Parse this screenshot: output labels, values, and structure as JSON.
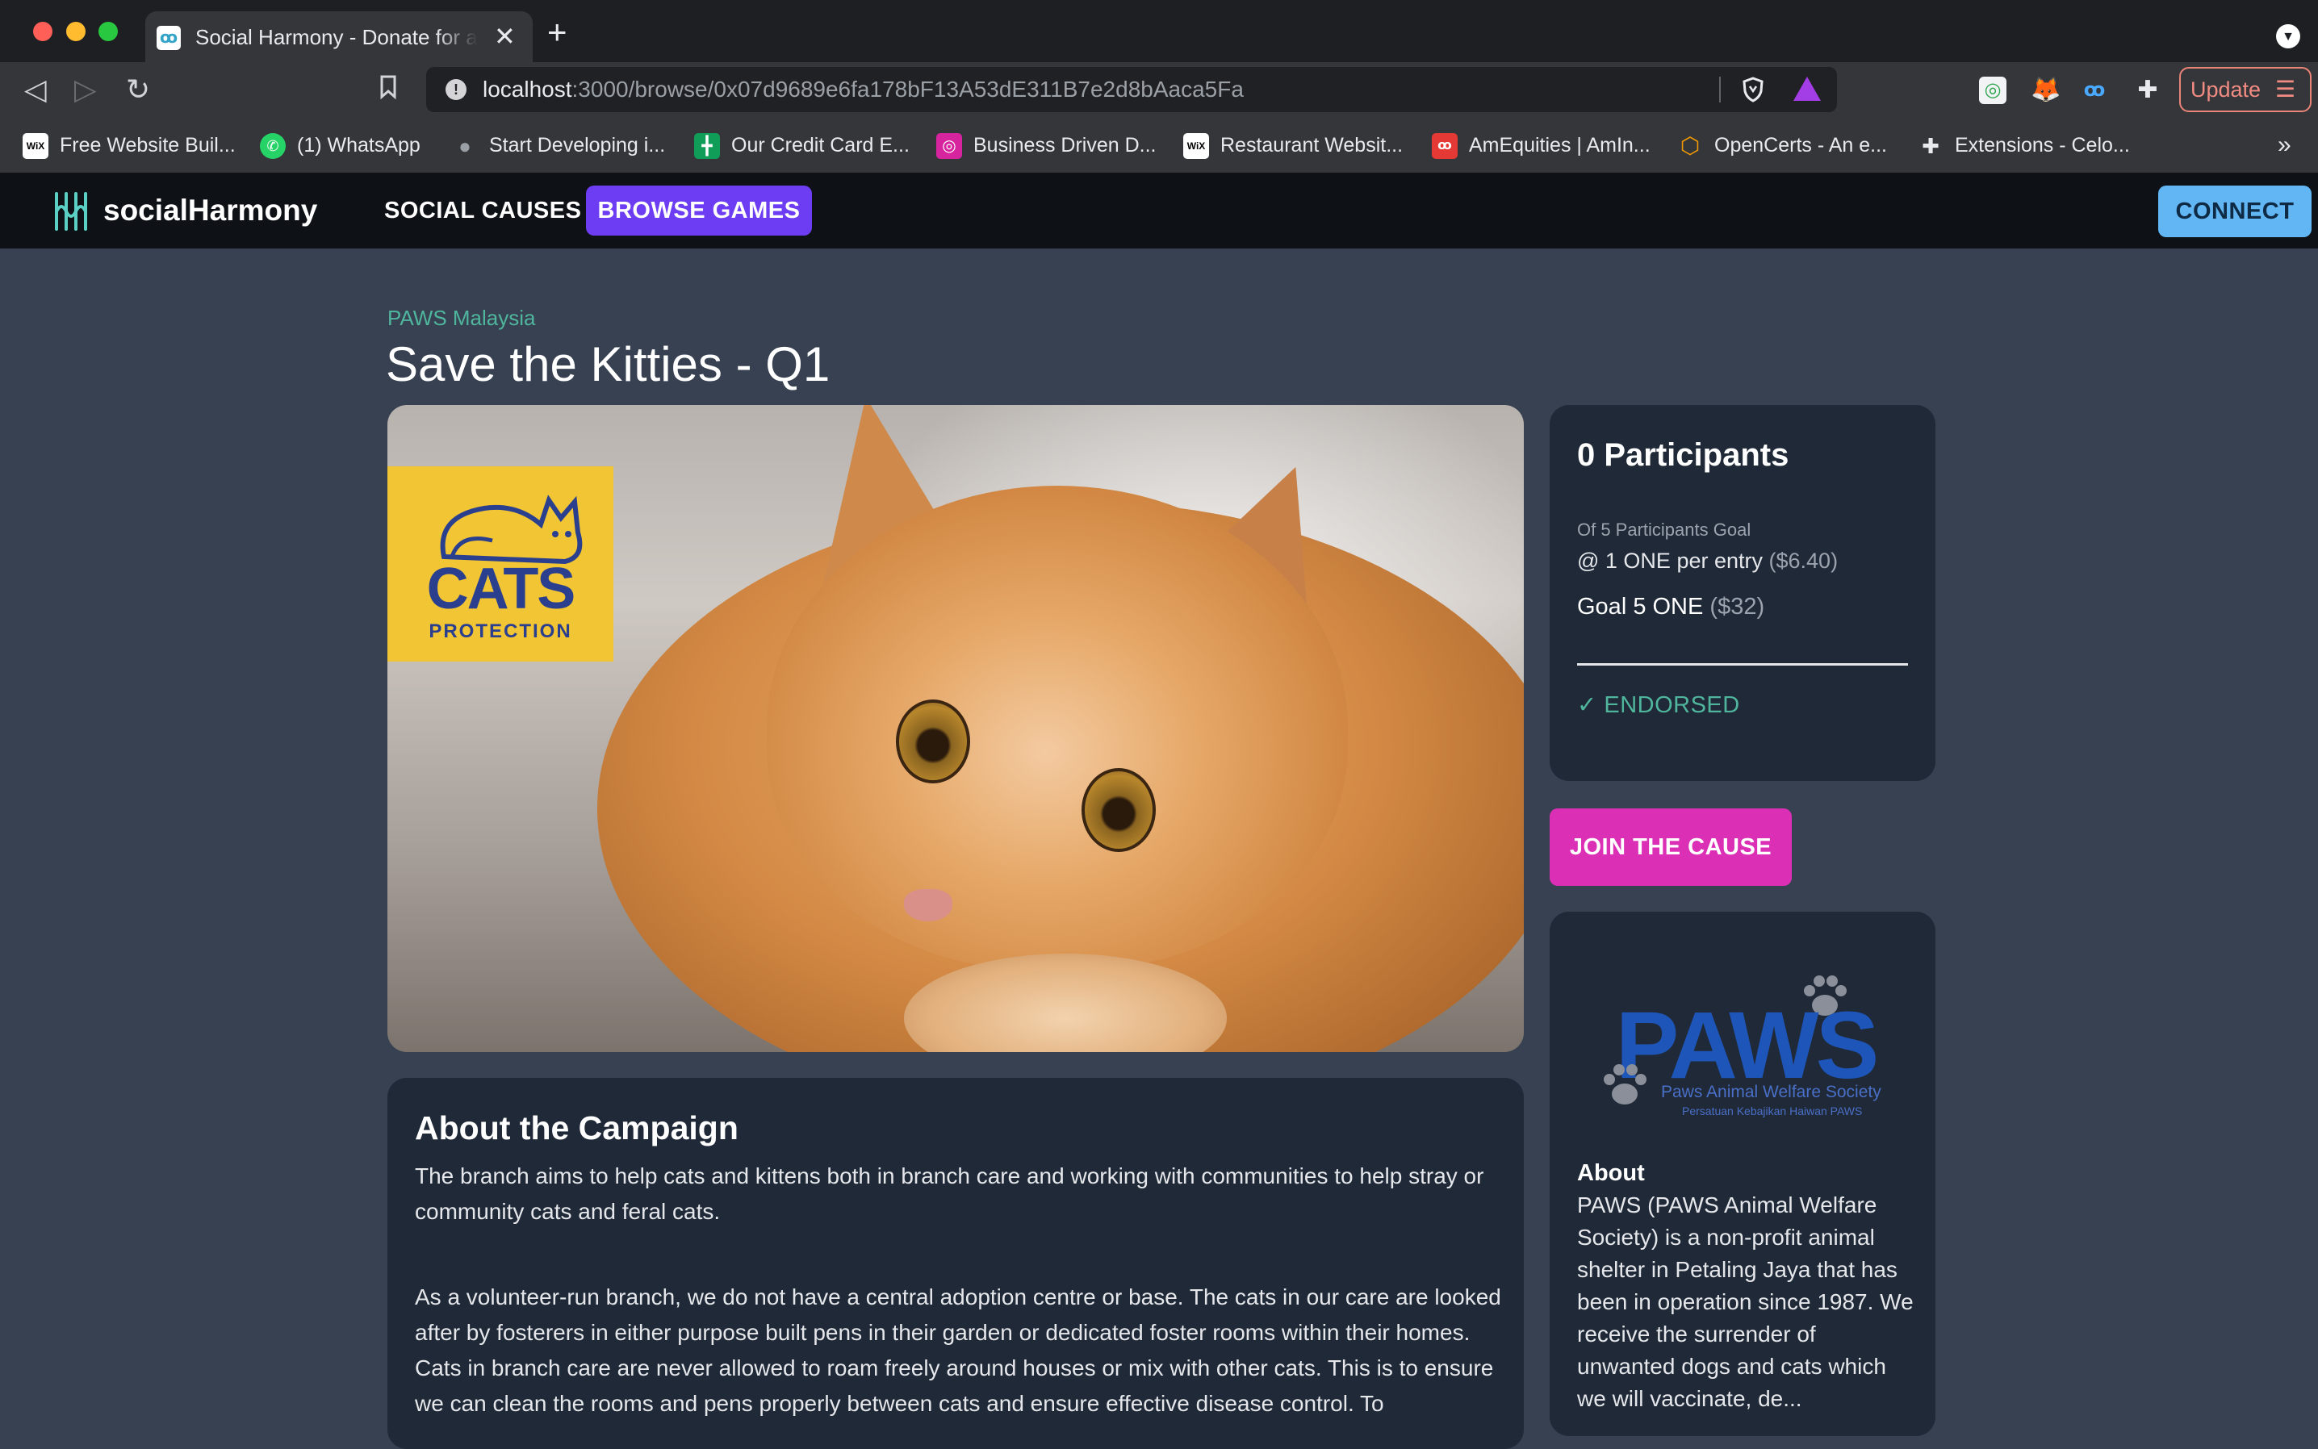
{
  "browser": {
    "tab_title": "Social Harmony - Donate for a Cause",
    "url_host": "localhost",
    "url_path": ":3000/browse/0x07d9689e6fa178bF13A53dE311B7e2d8bAaca5Fa",
    "update_label": "Update",
    "bookmarks": [
      {
        "label": "Free Website Buil...",
        "icon": "wix-icon"
      },
      {
        "label": "(1) WhatsApp",
        "icon": "whatsapp-icon"
      },
      {
        "label": "Start Developing i...",
        "icon": "apple-icon"
      },
      {
        "label": "Our Credit Card E...",
        "icon": "sheets-icon"
      },
      {
        "label": "Business Driven D...",
        "icon": "instagram-icon"
      },
      {
        "label": "Restaurant Websit...",
        "icon": "wix-icon"
      },
      {
        "label": "AmEquities | AmIn...",
        "icon": "amequities-icon"
      },
      {
        "label": "OpenCerts - An e...",
        "icon": "opencerts-icon"
      },
      {
        "label": "Extensions - Celo...",
        "icon": "puzzle-icon"
      }
    ],
    "bookmarks_more": "»"
  },
  "header": {
    "logo_text": "socialHarmony",
    "nav_social_causes": "SOCIAL CAUSES",
    "nav_browse_games": "BROWSE GAMES",
    "connect_label": "CONNECT"
  },
  "campaign": {
    "org_name": "PAWS Malaysia",
    "title": "Save the Kitties - Q1",
    "hero_logo_title": "CATS",
    "hero_logo_sub": "PROTECTION"
  },
  "stats": {
    "participants_title": "0 Participants",
    "goal_label": "Of 5 Participants Goal",
    "entry_text": "@ 1 ONE per entry",
    "entry_usd": "($6.40)",
    "goal_text": "Goal 5 ONE",
    "goal_usd": "($32)",
    "endorsed_label": "✓ ENDORSED"
  },
  "join_label": "JOIN THE CAUSE",
  "org_card": {
    "logo_word": "PAWS",
    "logo_sub1": "Paws Animal Welfare Society",
    "logo_sub2": "Persatuan Kebajikan Haiwan PAWS",
    "about_heading": "About",
    "about_text": "PAWS (PAWS Animal Welfare Society) is a non-profit animal shelter in Petaling Jaya that has been in operation since 1987. We receive the surrender of unwanted dogs and cats which we will vaccinate, de..."
  },
  "about_campaign": {
    "heading": "About the Campaign",
    "paragraph1": "The branch aims to help cats and kittens both in branch care and working with communities to help stray or community cats and feral cats.",
    "paragraph2": "As a volunteer-run branch, we do not have a central adoption centre or base. The cats in our care are looked after by fosterers in either purpose built pens in their garden or dedicated foster rooms within their homes. Cats in branch care are never allowed to roam freely around houses or mix with other cats. This is to ensure we can clean the rooms and pens properly between cats and ensure effective disease control. To"
  },
  "colors": {
    "page_bg": "#374151",
    "header_bg": "#0e1116",
    "card_bg": "#1f2937",
    "accent_purple": "#6d3df3",
    "accent_pink": "#db2fb6",
    "accent_blue": "#63b6f4",
    "accent_teal": "#4fb69d"
  }
}
